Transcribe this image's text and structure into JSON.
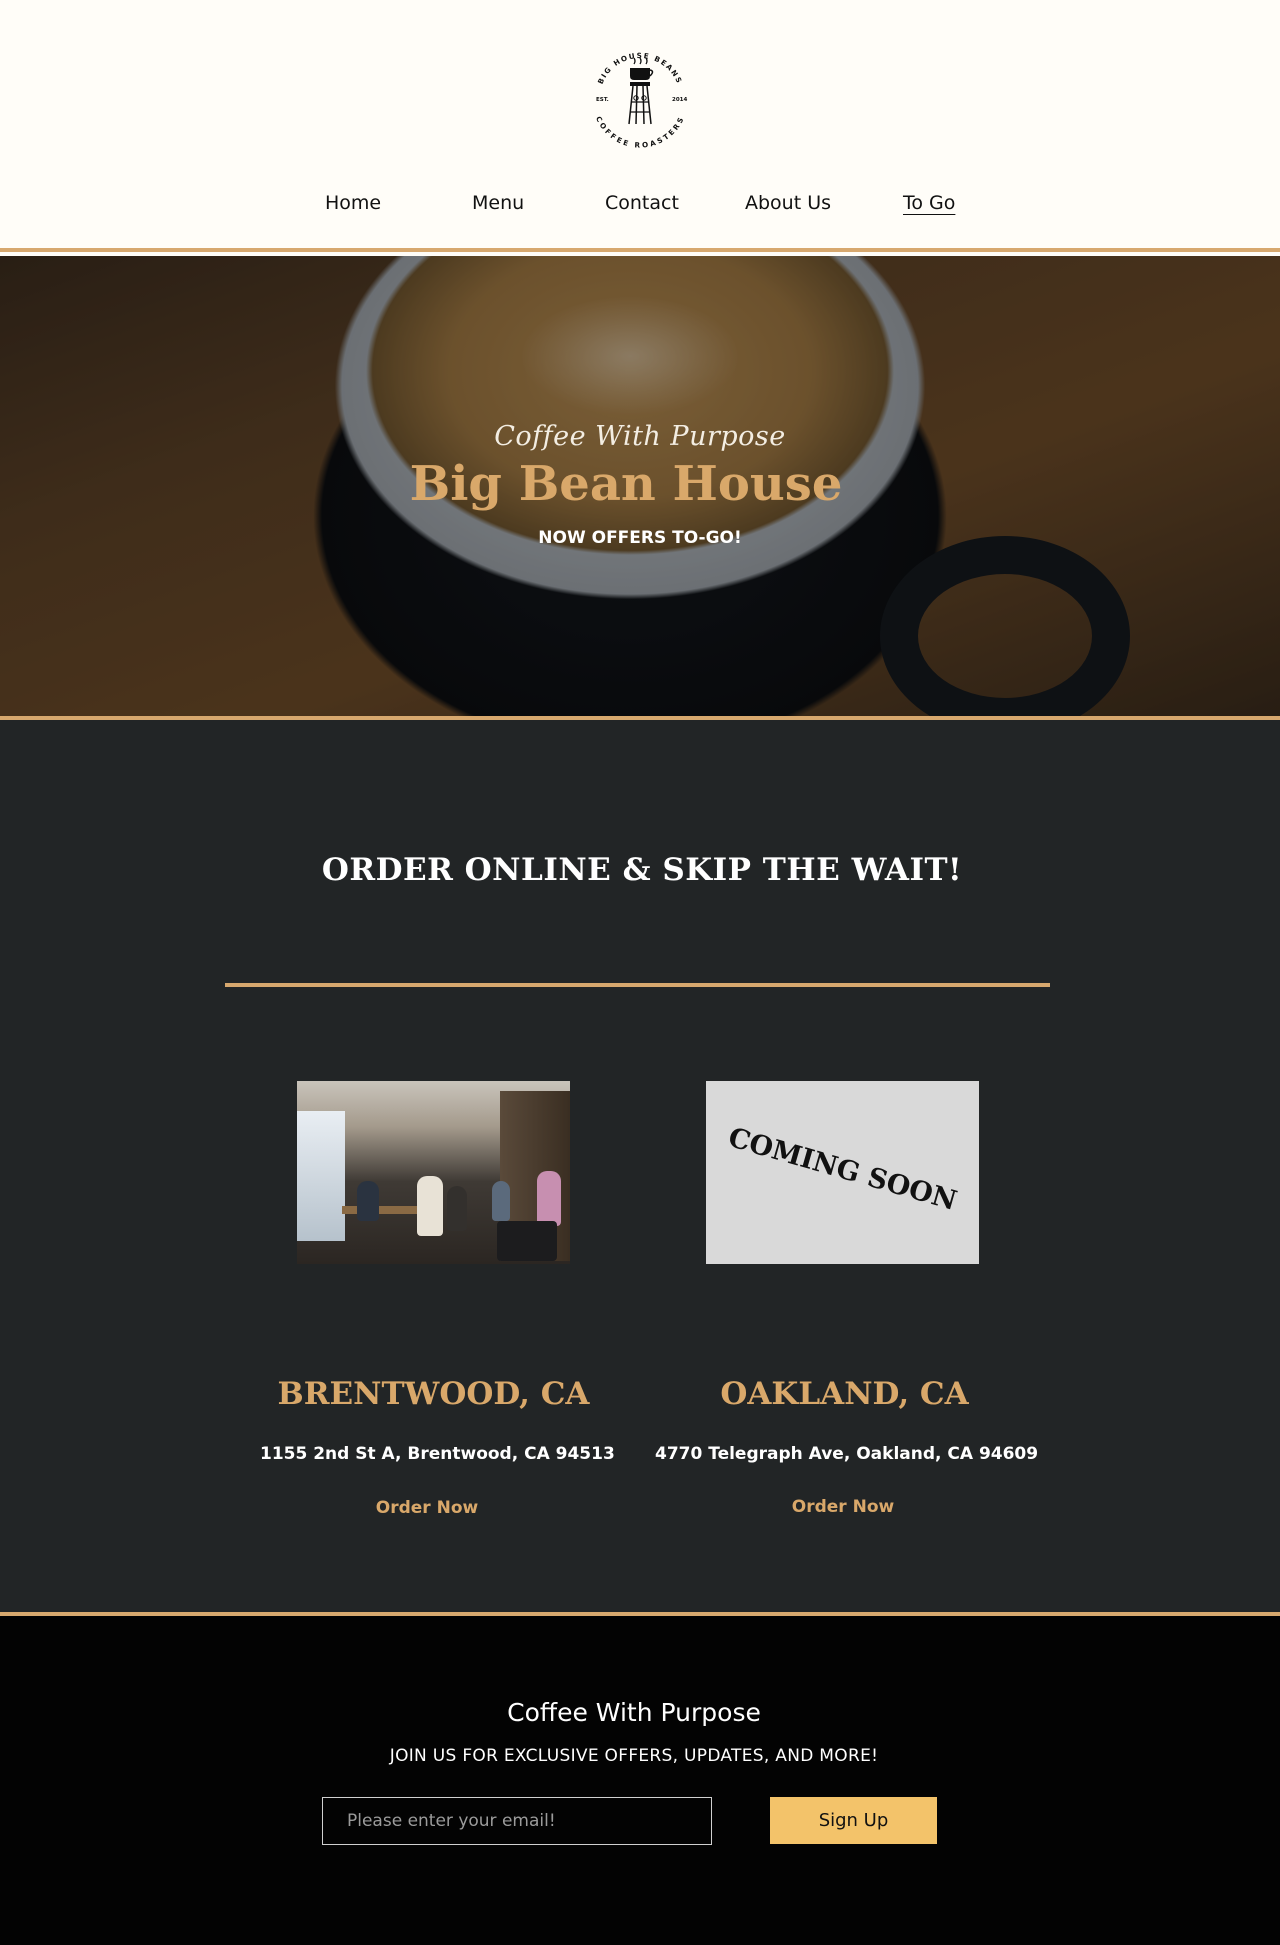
{
  "header": {
    "logo": {
      "icon": "water-tower-coffee-cup-icon",
      "text_top": "BIG HOUSE BEANS",
      "text_bottom": "COFFEE ROASTERS",
      "est_label": "EST.",
      "est_year": "2014"
    },
    "nav": {
      "home": "Home",
      "menu": "Menu",
      "contact": "Contact",
      "about": "About Us",
      "togo": "To Go"
    }
  },
  "hero": {
    "tagline": "Coffee With Purpose",
    "title": "Big Bean House",
    "subtitle": "NOW OFFERS TO-GO!"
  },
  "locations": {
    "heading": "ORDER ONLINE & SKIP THE WAIT!",
    "items": [
      {
        "city": "BRENTWOOD, CA",
        "address": "1155 2nd St A, Brentwood, CA 94513",
        "order_label": "Order Now"
      },
      {
        "city": "OAKLAND, CA",
        "address": "4770 Telegraph Ave, Oakland, CA 94609",
        "order_label": "Order Now",
        "placeholder_text": "COMING SOON"
      }
    ]
  },
  "footer": {
    "title": "Coffee With Purpose",
    "subtitle": "JOIN US FOR EXCLUSIVE OFFERS, UPDATES, AND MORE!",
    "email_placeholder": "Please enter your email!",
    "signup_label": "Sign Up"
  },
  "colors": {
    "accent_gold": "#d7a86e",
    "dark_section": "#222526",
    "footer_bg": "#030303",
    "button_yellow": "#f3c36a",
    "header_bg": "#fffdf8"
  }
}
